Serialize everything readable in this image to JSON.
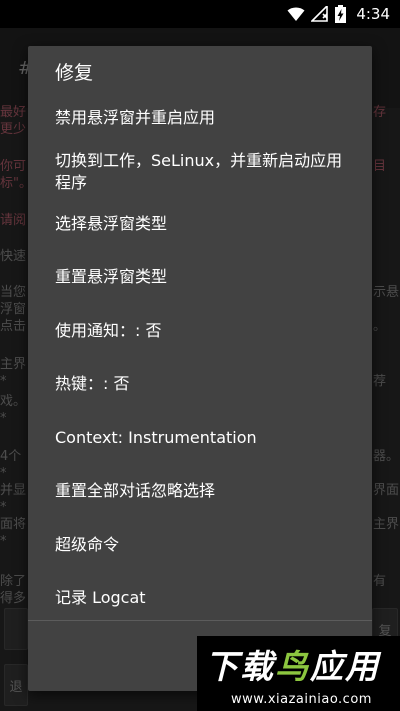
{
  "status_bar": {
    "time": "4:34",
    "icons": [
      "wifi-icon",
      "no-signal-icon",
      "battery-charging-icon"
    ]
  },
  "background": {
    "header_symbol": "#",
    "lines": [
      {
        "text": "最好",
        "class": "red"
      },
      {
        "text": "更少",
        "class": "red"
      },
      {
        "text": "你可",
        "class": "red"
      },
      {
        "text": "标\"。",
        "class": "red"
      },
      {
        "text": "请阅",
        "class": "red"
      },
      {
        "text": "快速",
        "class": ""
      },
      {
        "text": "当您",
        "class": ""
      },
      {
        "text": "浮窗",
        "class": ""
      },
      {
        "text": "点击",
        "class": ""
      },
      {
        "text": "主界",
        "class": ""
      },
      {
        "text": "  *",
        "class": ""
      },
      {
        "text": "戏。",
        "class": ""
      },
      {
        "text": "  *",
        "class": ""
      },
      {
        "text": "4个",
        "class": ""
      },
      {
        "text": "  *",
        "class": ""
      },
      {
        "text": "并显",
        "class": ""
      },
      {
        "text": "  *",
        "class": ""
      },
      {
        "text": "面将",
        "class": ""
      },
      {
        "text": "  *",
        "class": ""
      },
      {
        "text": "除了",
        "class": ""
      },
      {
        "text": "得多",
        "class": ""
      }
    ],
    "right_fragments": [
      "存",
      "",
      "目",
      "",
      "示悬",
      "。",
      "荐",
      "器。",
      "界面",
      "主界",
      "有"
    ],
    "bottom_left_button": "退",
    "bottom_right_button": "复"
  },
  "menu": {
    "title": "修复",
    "items": [
      "禁用悬浮窗并重启应用",
      "切换到工作，SeLinux，并重新启动应用程序",
      "选择悬浮窗类型",
      "重置悬浮窗类型",
      "使用通知：: 否",
      "热键：: 否",
      "Context: Instrumentation",
      "重置全部对话忽略选择",
      "超级命令",
      "记录 Logcat"
    ]
  },
  "watermark": {
    "brand_white": "下载",
    "brand_green": "鸟",
    "brand_white2": "应用",
    "url": "www.xiazainiao.com"
  }
}
